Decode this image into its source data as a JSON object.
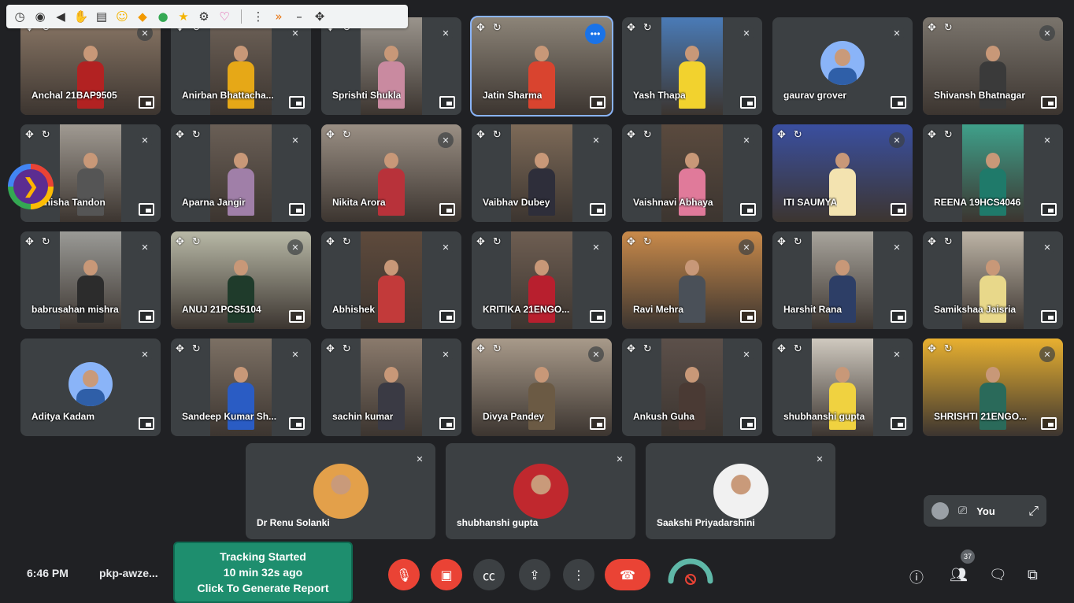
{
  "extension_bar": {
    "icons": [
      "clock-icon",
      "eye-icon",
      "speaker-icon",
      "raise-hand-icon",
      "clipboard-icon",
      "emoji-icon",
      "bookmark-icon",
      "chat-bubble-icon",
      "star-icon",
      "gear-icon",
      "shield-icon",
      "more-vert-icon",
      "fast-forward-icon",
      "minimize-icon",
      "move-icon"
    ]
  },
  "participants": [
    {
      "name": "Anchal 21BAP9505",
      "type": "video",
      "shirt": "#b22222",
      "bg": "#8a7766"
    },
    {
      "name": "Anirban Bhattacha...",
      "type": "video",
      "shirt": "#e6a817",
      "bg": "#6e6258"
    },
    {
      "name": "Sprishti Shukla",
      "type": "video",
      "shirt": "#c98aa0",
      "bg": "#9a948c"
    },
    {
      "name": "Jatin Sharma",
      "type": "video",
      "shirt": "#d9442f",
      "bg": "#8c8478",
      "speaking": true
    },
    {
      "name": "Yash Thapa",
      "type": "video",
      "shirt": "#f2d22e",
      "bg": "#4a7bb7"
    },
    {
      "name": "gaurav grover",
      "type": "avatar"
    },
    {
      "name": "Shivansh Bhatnagar",
      "type": "video",
      "shirt": "#3a3a3a",
      "bg": "#7a746c"
    },
    {
      "name": "Manisha Tandon",
      "type": "video",
      "shirt": "#555555",
      "bg": "#a09a92"
    },
    {
      "name": "Aparna Jangir",
      "type": "video",
      "shirt": "#a07fa8",
      "bg": "#6a5f56"
    },
    {
      "name": "Nikita Arora",
      "type": "video",
      "shirt": "#b8323a",
      "bg": "#9a8f84"
    },
    {
      "name": "Vaibhav Dubey",
      "type": "video",
      "shirt": "#2e2e3a",
      "bg": "#7d6a58"
    },
    {
      "name": "Vaishnavi Abhaya",
      "type": "video",
      "shirt": "#e07a9a",
      "bg": "#5a4a3e"
    },
    {
      "name": "ITI SAUMYA",
      "type": "video",
      "shirt": "#f3e3b0",
      "bg": "#3a4fa0"
    },
    {
      "name": "REENA 19HCS4046",
      "type": "video",
      "shirt": "#1f7a6a",
      "bg": "#3fa08a"
    },
    {
      "name": "babrusahan mishra",
      "type": "video",
      "shirt": "#2c2c2c",
      "bg": "#9a9a96"
    },
    {
      "name": "ANUJ 21PCS5104",
      "type": "video",
      "shirt": "#1f3b2b",
      "bg": "#b8b8a6"
    },
    {
      "name": "Abhishek",
      "type": "video",
      "shirt": "#c23a3a",
      "bg": "#5e4a3c"
    },
    {
      "name": "KRITIKA 21ENGO...",
      "type": "video",
      "shirt": "#b81f2e",
      "bg": "#6e5e52"
    },
    {
      "name": "Ravi Mehra",
      "type": "video",
      "shirt": "#4a5058",
      "bg": "#c98a4a"
    },
    {
      "name": "Harshit Rana",
      "type": "video",
      "shirt": "#2d3e66",
      "bg": "#a8a49c"
    },
    {
      "name": "Samikshaa Jaisria",
      "type": "video",
      "shirt": "#e8d88a",
      "bg": "#bdb4a6"
    },
    {
      "name": "Aditya Kadam",
      "type": "avatar"
    },
    {
      "name": "Sandeep Kumar Sh...",
      "type": "video",
      "shirt": "#2a5cc4",
      "bg": "#7c7064"
    },
    {
      "name": "sachin kumar",
      "type": "video",
      "shirt": "#3a3a44",
      "bg": "#8a7a6c"
    },
    {
      "name": "Divya Pandey",
      "type": "video",
      "shirt": "#6b5a44",
      "bg": "#a89a8a"
    },
    {
      "name": "Ankush Guha",
      "type": "video",
      "shirt": "#4a3a34",
      "bg": "#5c504a"
    },
    {
      "name": "shubhanshi gupta",
      "type": "video",
      "shirt": "#f0d240",
      "bg": "#cfc9bf"
    },
    {
      "name": "SHRISHTI 21ENGO...",
      "type": "video",
      "shirt": "#2a6a5a",
      "bg": "#e8b030"
    }
  ],
  "bottom_row": [
    {
      "name": "Dr Renu Solanki",
      "avatar_color": "#e3a04a"
    },
    {
      "name": "shubhanshi gupta",
      "avatar_color": "#c0282e"
    },
    {
      "name": "Saakshi Priyadarshini",
      "avatar_color": "#f1f1f1"
    }
  ],
  "self_view": {
    "label": "You"
  },
  "status": {
    "time": "6:46 PM",
    "meeting_code": "pkp-awze..."
  },
  "tracking": {
    "line1": "Tracking Started",
    "line2": "10 min 32s ago",
    "line3": "Click To Generate Report"
  },
  "controls": [
    "mic-off-icon",
    "camera-off-icon",
    "captions-icon",
    "present-icon",
    "more-options-icon",
    "end-call-icon"
  ],
  "right_controls": {
    "people_count": "37"
  },
  "colors": {
    "background": "#202124",
    "tile": "#3c4043",
    "danger": "#ea4335",
    "tracking_green": "#1e8e6e",
    "speaking_outline": "#8ab4f8"
  }
}
